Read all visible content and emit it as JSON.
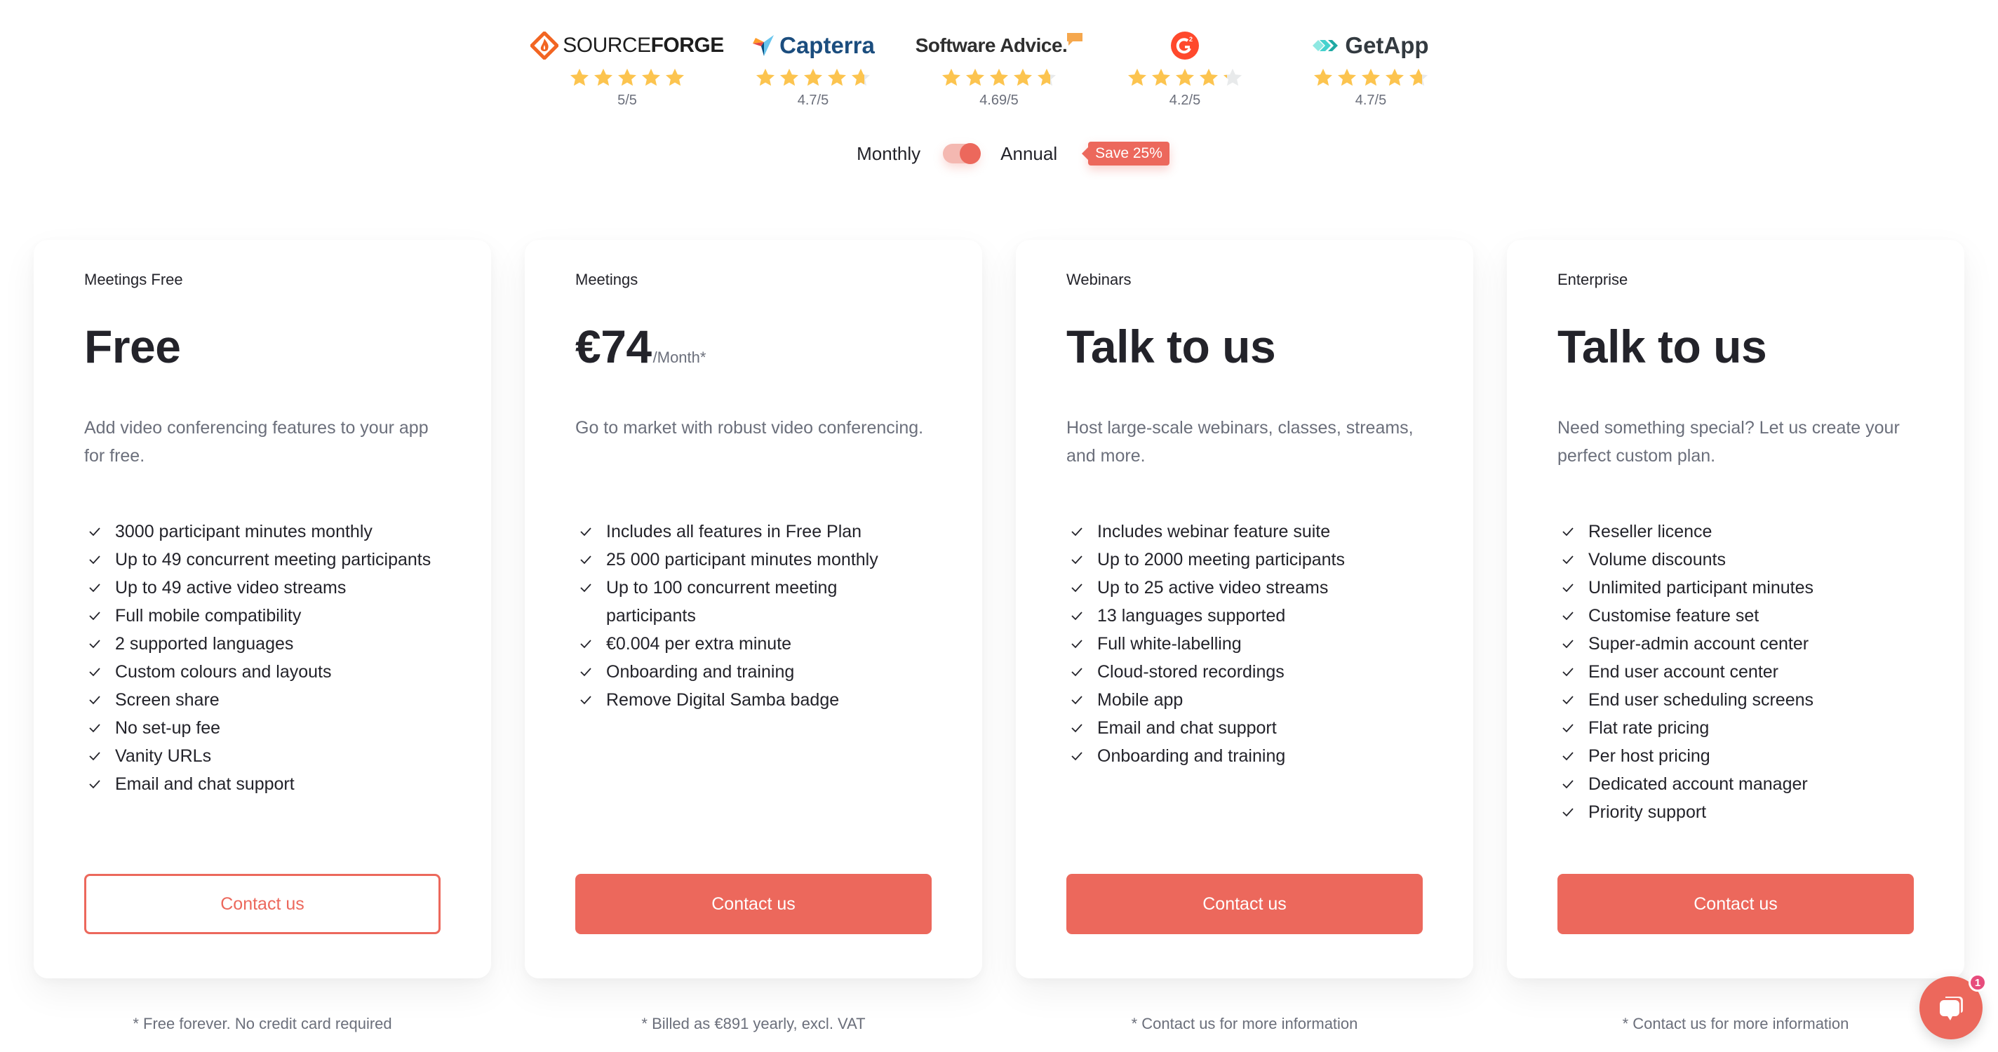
{
  "reviews": [
    {
      "name": "SourceForge",
      "logo_icon": "sourceforge-logo-icon",
      "logo_text_light": "SOURCE",
      "logo_text_bold": "FORGE",
      "rating_value": 5,
      "rating_label": "5/5"
    },
    {
      "name": "Capterra",
      "logo_icon": "capterra-logo-icon",
      "logo_text": "Capterra",
      "rating_value": 4.7,
      "rating_label": "4.7/5"
    },
    {
      "name": "Software Advice",
      "logo_icon": "software-advice-logo-icon",
      "logo_text": "Software Advice.",
      "rating_value": 4.69,
      "rating_label": "4.69/5"
    },
    {
      "name": "G2",
      "logo_icon": "g2-logo-icon",
      "logo_text": "G2",
      "rating_value": 4.2,
      "rating_label": "4.2/5"
    },
    {
      "name": "GetApp",
      "logo_icon": "getapp-logo-icon",
      "logo_text": "GetApp",
      "rating_value": 4.7,
      "rating_label": "4.7/5"
    }
  ],
  "billing": {
    "monthly_label": "Monthly",
    "annual_label": "Annual",
    "selected": "Annual",
    "save_badge": "Save 25%"
  },
  "plans": [
    {
      "name": "Meetings Free",
      "price": "Free",
      "price_unit": "",
      "description": "Add video conferencing features to your app for free.",
      "features": [
        "3000 participant minutes monthly",
        "Up to 49 concurrent meeting participants",
        "Up to 49 active video streams",
        "Full mobile compatibility",
        "2 supported languages",
        "Custom colours and layouts",
        "Screen share",
        "No set-up fee",
        "Vanity URLs",
        "Email and chat support"
      ],
      "cta_label": "Contact us",
      "cta_style": "outline",
      "footnote": "* Free forever. No credit card required"
    },
    {
      "name": "Meetings",
      "price": "€74",
      "price_unit": "/Month*",
      "description": "Go to market with robust video conferencing.",
      "features": [
        "Includes all features in Free Plan",
        "25 000 participant minutes monthly",
        "Up to 100 concurrent meeting participants",
        "€0.004 per extra minute",
        "Onboarding and training",
        "Remove Digital Samba badge"
      ],
      "cta_label": "Contact us",
      "cta_style": "solid",
      "footnote": "* Billed as €891 yearly, excl. VAT"
    },
    {
      "name": "Webinars",
      "price": "Talk to us",
      "price_unit": "",
      "description": "Host large-scale webinars, classes, streams, and more.",
      "features": [
        "Includes webinar feature suite",
        "Up to 2000 meeting participants",
        "Up to 25 active video streams",
        "13 languages supported",
        "Full white-labelling",
        "Cloud-stored recordings",
        "Mobile app",
        "Email and chat support",
        "Onboarding and training"
      ],
      "cta_label": "Contact us",
      "cta_style": "solid",
      "footnote": "* Contact us for more information"
    },
    {
      "name": "Enterprise",
      "price": "Talk to us",
      "price_unit": "",
      "description": "Need something special? Let us create your perfect custom plan.",
      "features": [
        "Reseller licence",
        "Volume discounts",
        "Unlimited participant minutes",
        "Customise feature set",
        "Super-admin account center",
        "End user account center",
        "End user scheduling screens",
        "Flat rate pricing",
        "Per host pricing",
        "Dedicated account manager",
        "Priority support"
      ],
      "cta_label": "Contact us",
      "cta_style": "solid",
      "footnote": "* Contact us for more information"
    }
  ],
  "chat_widget": {
    "icon": "chat-bubbles-icon",
    "unread_count": "1"
  },
  "colors": {
    "accent": "#ec685c",
    "star": "#fcc44f",
    "star_empty": "#e8eaeb",
    "text": "#23232a",
    "muted": "#6b6f7b",
    "chat_badge": "#e74c7c"
  }
}
